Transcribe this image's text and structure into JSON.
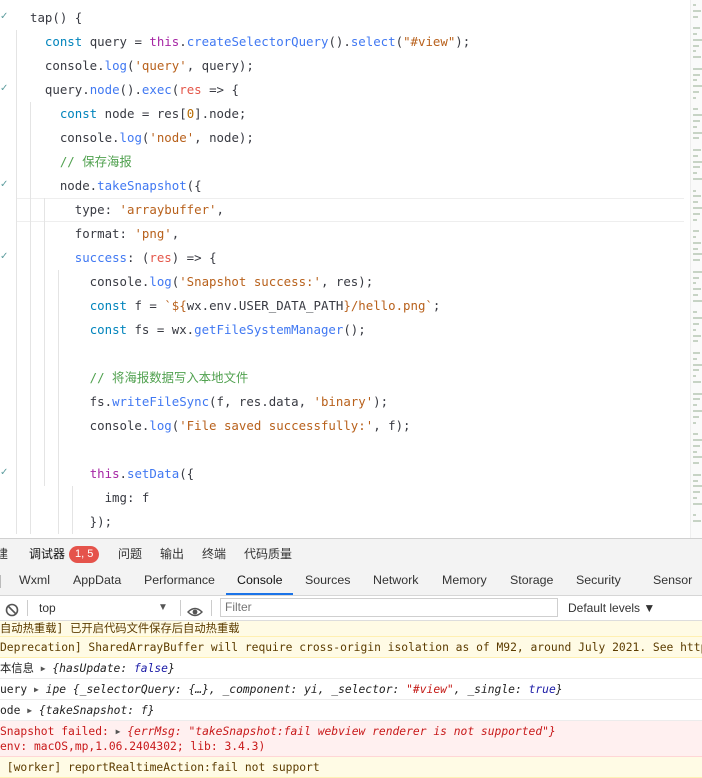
{
  "editor": {
    "lines": [
      [
        {
          "t": "tap() {",
          "c": "pl"
        }
      ],
      [
        {
          "t": "  ",
          "c": "pl"
        },
        {
          "t": "const",
          "c": "kw"
        },
        {
          "t": " query = ",
          "c": "pl"
        },
        {
          "t": "this",
          "c": "kw2"
        },
        {
          "t": ".",
          "c": "pl"
        },
        {
          "t": "createSelectorQuery",
          "c": "fn"
        },
        {
          "t": "().",
          "c": "pl"
        },
        {
          "t": "select",
          "c": "fn"
        },
        {
          "t": "(",
          "c": "pl"
        },
        {
          "t": "\"#view\"",
          "c": "str2"
        },
        {
          "t": ");",
          "c": "pl"
        }
      ],
      [
        {
          "t": "  console.",
          "c": "pl"
        },
        {
          "t": "log",
          "c": "fn"
        },
        {
          "t": "(",
          "c": "pl"
        },
        {
          "t": "'query'",
          "c": "str2"
        },
        {
          "t": ", query);",
          "c": "pl"
        }
      ],
      [
        {
          "t": "  query.",
          "c": "pl"
        },
        {
          "t": "node",
          "c": "fn"
        },
        {
          "t": "().",
          "c": "pl"
        },
        {
          "t": "exec",
          "c": "fn"
        },
        {
          "t": "(",
          "c": "pl"
        },
        {
          "t": "res",
          "c": "prop"
        },
        {
          "t": " => {",
          "c": "pl"
        }
      ],
      [
        {
          "t": "    ",
          "c": "pl"
        },
        {
          "t": "const",
          "c": "kw"
        },
        {
          "t": " node = res[",
          "c": "pl"
        },
        {
          "t": "0",
          "c": "num"
        },
        {
          "t": "].node;",
          "c": "pl"
        }
      ],
      [
        {
          "t": "    console.",
          "c": "pl"
        },
        {
          "t": "log",
          "c": "fn"
        },
        {
          "t": "(",
          "c": "pl"
        },
        {
          "t": "'node'",
          "c": "str2"
        },
        {
          "t": ", node);",
          "c": "pl"
        }
      ],
      [
        {
          "t": "    // 保存海报",
          "c": "com"
        }
      ],
      [
        {
          "t": "    node.",
          "c": "pl"
        },
        {
          "t": "takeSnapshot",
          "c": "fn"
        },
        {
          "t": "({",
          "c": "pl"
        }
      ],
      [
        {
          "t": "      type: ",
          "c": "pl"
        },
        {
          "t": "'arraybuffer'",
          "c": "str2"
        },
        {
          "t": ",",
          "c": "pl"
        }
      ],
      [
        {
          "t": "      format: ",
          "c": "pl"
        },
        {
          "t": "'png'",
          "c": "str2"
        },
        {
          "t": ",",
          "c": "pl"
        }
      ],
      [
        {
          "t": "      ",
          "c": "pl"
        },
        {
          "t": "success",
          "c": "fn"
        },
        {
          "t": ": (",
          "c": "pl"
        },
        {
          "t": "res",
          "c": "prop"
        },
        {
          "t": ") => {",
          "c": "pl"
        }
      ],
      [
        {
          "t": "        console.",
          "c": "pl"
        },
        {
          "t": "log",
          "c": "fn"
        },
        {
          "t": "(",
          "c": "pl"
        },
        {
          "t": "'Snapshot success:'",
          "c": "str2"
        },
        {
          "t": ", res);",
          "c": "pl"
        }
      ],
      [
        {
          "t": "        ",
          "c": "pl"
        },
        {
          "t": "const",
          "c": "kw"
        },
        {
          "t": " f = ",
          "c": "pl"
        },
        {
          "t": "`${",
          "c": "str2"
        },
        {
          "t": "wx.env.USER_DATA_PATH",
          "c": "tplv"
        },
        {
          "t": "}/hello.png`",
          "c": "str2"
        },
        {
          "t": ";",
          "c": "pl"
        }
      ],
      [
        {
          "t": "        ",
          "c": "pl"
        },
        {
          "t": "const",
          "c": "kw"
        },
        {
          "t": " fs = wx.",
          "c": "pl"
        },
        {
          "t": "getFileSystemManager",
          "c": "fn"
        },
        {
          "t": "();",
          "c": "pl"
        }
      ],
      [
        {
          "t": "",
          "c": "pl"
        }
      ],
      [
        {
          "t": "        // 将海报数据写入本地文件",
          "c": "com"
        }
      ],
      [
        {
          "t": "        fs.",
          "c": "pl"
        },
        {
          "t": "writeFileSync",
          "c": "fn"
        },
        {
          "t": "(f, res.data, ",
          "c": "pl"
        },
        {
          "t": "'binary'",
          "c": "str2"
        },
        {
          "t": ");",
          "c": "pl"
        }
      ],
      [
        {
          "t": "        console.",
          "c": "pl"
        },
        {
          "t": "log",
          "c": "fn"
        },
        {
          "t": "(",
          "c": "pl"
        },
        {
          "t": "'File saved successfully:'",
          "c": "str2"
        },
        {
          "t": ", f);",
          "c": "pl"
        }
      ],
      [
        {
          "t": "",
          "c": "pl"
        }
      ],
      [
        {
          "t": "        ",
          "c": "pl"
        },
        {
          "t": "this",
          "c": "kw2"
        },
        {
          "t": ".",
          "c": "pl"
        },
        {
          "t": "setData",
          "c": "fn"
        },
        {
          "t": "({",
          "c": "pl"
        }
      ],
      [
        {
          "t": "          img: f",
          "c": "pl"
        }
      ],
      [
        {
          "t": "        });",
          "c": "pl"
        }
      ]
    ],
    "current_line": 8
  },
  "panel_tabs": {
    "items": [
      "建",
      "调试器",
      "问题",
      "输出",
      "终端",
      "代码质量"
    ],
    "badge": "1, 5"
  },
  "devtools_tabs": [
    "Wxml",
    "AppData",
    "Performance",
    "Console",
    "Sources",
    "Network",
    "Memory",
    "Storage",
    "Security",
    "Sensor"
  ],
  "console_toolbar": {
    "context": "top",
    "filter_placeholder": "Filter",
    "levels": "Default levels ▼"
  },
  "console": {
    "messages": [
      {
        "type": "warn",
        "parts": [
          {
            "t": "自动热重载] 已开启代码文件保存后自动热重载"
          }
        ]
      },
      {
        "type": "warn",
        "parts": [
          {
            "t": "Deprecation] SharedArrayBuffer will require cross-origin isolation as of M92, around July 2021. See https:/"
          }
        ]
      },
      {
        "type": "log",
        "parts": [
          {
            "t": "本信息 "
          },
          {
            "t": "▶",
            "c": "tri"
          },
          {
            "t": " {",
            "c": "i"
          },
          {
            "t": "hasUpdate",
            "c": "i"
          },
          {
            "t": ": ",
            "c": "i"
          },
          {
            "t": "false",
            "c": "i kv"
          },
          {
            "t": "}",
            "c": "i"
          }
        ]
      },
      {
        "type": "log",
        "parts": [
          {
            "t": "uery "
          },
          {
            "t": "▶",
            "c": "tri"
          },
          {
            "t": " ipe {_selectorQuery: {…}, _component: yi, _selector: ",
            "c": "i"
          },
          {
            "t": "\"#view\"",
            "c": "i sv"
          },
          {
            "t": ", _single: ",
            "c": "i"
          },
          {
            "t": "true",
            "c": "i kv"
          },
          {
            "t": "}",
            "c": "i"
          }
        ]
      },
      {
        "type": "log",
        "parts": [
          {
            "t": "ode "
          },
          {
            "t": "▶",
            "c": "tri"
          },
          {
            "t": " {takeSnapshot: f}",
            "c": "i"
          }
        ]
      },
      {
        "type": "err",
        "parts": [
          {
            "t": "Snapshot failed: "
          },
          {
            "t": "▶",
            "c": "tri"
          },
          {
            "t": " {errMsg: \"takeSnapshot:fail webview renderer is not supported\"}",
            "c": "i"
          }
        ],
        "line2": "env: macOS,mp,1.06.2404302; lib: 3.4.3)"
      },
      {
        "type": "warn",
        "parts": [
          {
            "t": " [worker] reportRealtimeAction:fail not support"
          }
        ]
      }
    ]
  }
}
